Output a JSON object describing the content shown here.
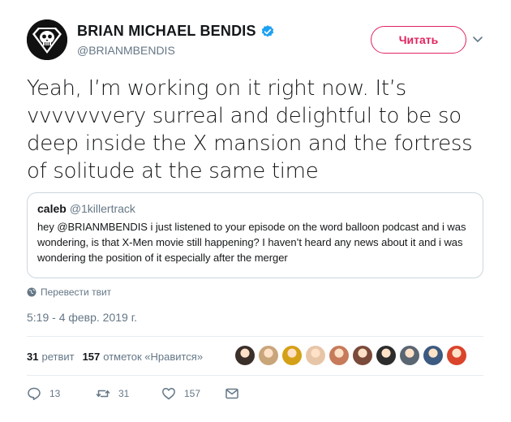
{
  "author": {
    "display_name": "BRIAN MICHAEL BENDIS",
    "handle": "@BRIANMBENDIS",
    "verified": true,
    "avatar_icon": "skull-superman-logo"
  },
  "follow_button": {
    "label": "Читать",
    "color": "#e0245e"
  },
  "menu_caret_icon": "chevron-down-icon",
  "tweet": {
    "text": "Yeah, I’m working on it right now. It’s vvvvvvvery surreal and delightful to be so deep inside the X mansion and the fortress of solitude at the same time"
  },
  "quoted_tweet": {
    "name": "caleb",
    "handle": "@1killertrack",
    "text": "hey @BRIANMBENDIS i just listened to your episode on the word balloon podcast and i was wondering, is that X-Men movie still happening?  I haven’t heard any news about it and i was wondering the position of it especially after the merger"
  },
  "translate_label": "Перевести твит",
  "timestamp": "5:19 - 4 февр. 2019 г.",
  "stats": {
    "retweets_count": "31",
    "retweets_label": "ретвит",
    "likes_count": "157",
    "likes_label": "отметок «Нравится»"
  },
  "liker_avatars": [
    "#3b2f2a",
    "#c9a57a",
    "#d4a017",
    "#e7c6a8",
    "#c77b5a",
    "#7a4a3a",
    "#2c2c2c",
    "#5a6672",
    "#3d5a80",
    "#d9442b"
  ],
  "actions": {
    "reply_count": "13",
    "retweet_count": "31",
    "like_count": "157"
  },
  "colors": {
    "accent_pink": "#e0245e",
    "verified_blue": "#1da1f2",
    "muted": "#657786",
    "border": "#ccd6dd"
  }
}
